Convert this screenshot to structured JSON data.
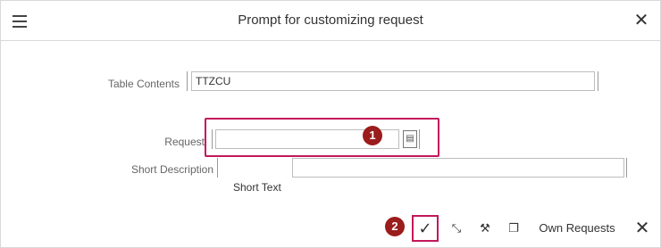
{
  "window": {
    "title": "Prompt for customizing request",
    "menu_icon": "hamburger-menu-icon",
    "close_icon": "close-icon"
  },
  "form": {
    "table_contents_label": "Table Contents",
    "table_contents_value": "TTZCU",
    "request_label": "Request",
    "request_value": "",
    "short_description_label": "Short Description",
    "short_description_value": "",
    "short_text_caption": "Short Text"
  },
  "annotations": {
    "badge_1": "1",
    "badge_2": "2",
    "highlight_color": "#c2185b",
    "badge_color": "#9b1c1c"
  },
  "toolbar": {
    "confirm_icon": "checkmark-icon",
    "icon2": "expand-icon",
    "icon3": "tools-icon",
    "icon4": "new-document-icon",
    "own_requests_label": "Own Requests",
    "cancel_icon": "close-icon"
  }
}
